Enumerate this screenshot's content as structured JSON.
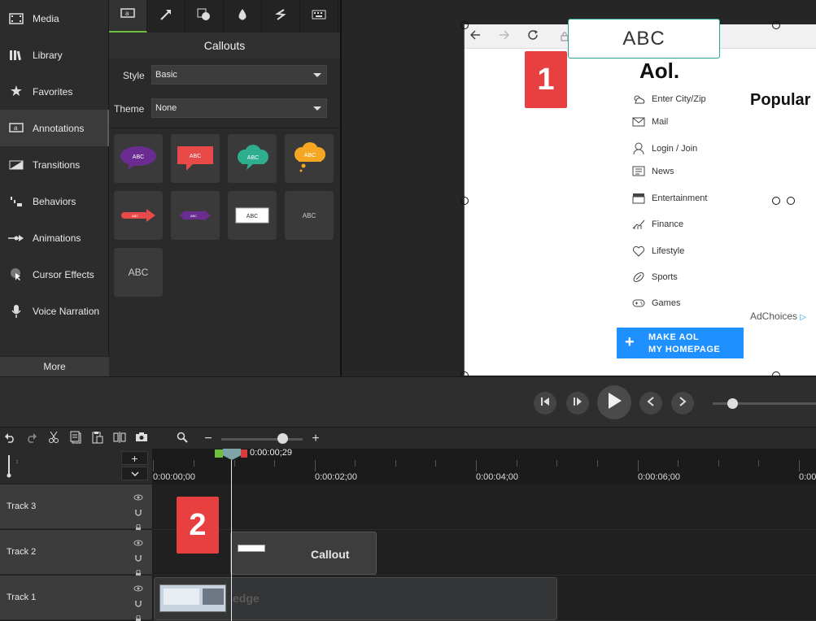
{
  "sidebar": {
    "items": [
      {
        "label": "Media",
        "icon": "film-strip-icon"
      },
      {
        "label": "Library",
        "icon": "books-icon"
      },
      {
        "label": "Favorites",
        "icon": "star-icon"
      },
      {
        "label": "Annotations",
        "icon": "callout-a-icon"
      },
      {
        "label": "Transitions",
        "icon": "transition-icon"
      },
      {
        "label": "Behaviors",
        "icon": "behaviors-icon"
      },
      {
        "label": "Animations",
        "icon": "animation-arrow-icon"
      },
      {
        "label": "Cursor Effects",
        "icon": "cursor-effects-icon"
      },
      {
        "label": "Voice Narration",
        "icon": "microphone-icon"
      }
    ],
    "active": "Annotations",
    "more_label": "More"
  },
  "panel": {
    "title": "Callouts",
    "style_label": "Style",
    "style_value": "Basic",
    "theme_label": "Theme",
    "theme_value": "None",
    "tiles": [
      {
        "text": "ABC",
        "kind": "speech-oval",
        "color": "#6a2c91"
      },
      {
        "text": "ABC",
        "kind": "speech-rect",
        "color": "#e84a4a"
      },
      {
        "text": "ABC",
        "kind": "cloud",
        "color": "#2fae8f"
      },
      {
        "text": "ABC",
        "kind": "thought-cloud",
        "color": "#f5a623"
      },
      {
        "text": "ABC",
        "kind": "arrow",
        "color": "#e84a4a"
      },
      {
        "text": "ABC",
        "kind": "arrow",
        "color": "#6a2c91"
      },
      {
        "text": "ABC",
        "kind": "box",
        "color": "#ffffff"
      },
      {
        "text": "ABC",
        "kind": "text",
        "color": "#cccccc"
      },
      {
        "text": "ABC",
        "kind": "text-large",
        "color": "#cccccc"
      }
    ]
  },
  "canvas": {
    "callout_text": "ABC",
    "badge1": "1",
    "aol": {
      "logo": "Aol.",
      "items": [
        "Enter City/Zip",
        "Mail",
        "Login / Join",
        "News",
        "Entertainment",
        "Finance",
        "Lifestyle",
        "Sports",
        "Games"
      ],
      "popular": "Popular",
      "adchoices": "AdChoices",
      "make_line1": "MAKE AOL",
      "make_line2": "MY HOMEPAGE"
    }
  },
  "timeline": {
    "badge2": "2",
    "playhead_time": "0:00:00;29",
    "ruler": [
      "0:00:00;00",
      "0:00:02;00",
      "0:00:04;00",
      "0:00:06;00",
      "0:00"
    ],
    "tracks": [
      "Track 3",
      "Track 2",
      "Track 1"
    ],
    "callout_clip_label": "Callout",
    "video_clip_label": "edge"
  },
  "colors": {
    "accent_green": "#6fbf3f",
    "badge_red": "#e84040",
    "aol_blue": "#1e90ff",
    "callout_teal": "#2aa198"
  }
}
